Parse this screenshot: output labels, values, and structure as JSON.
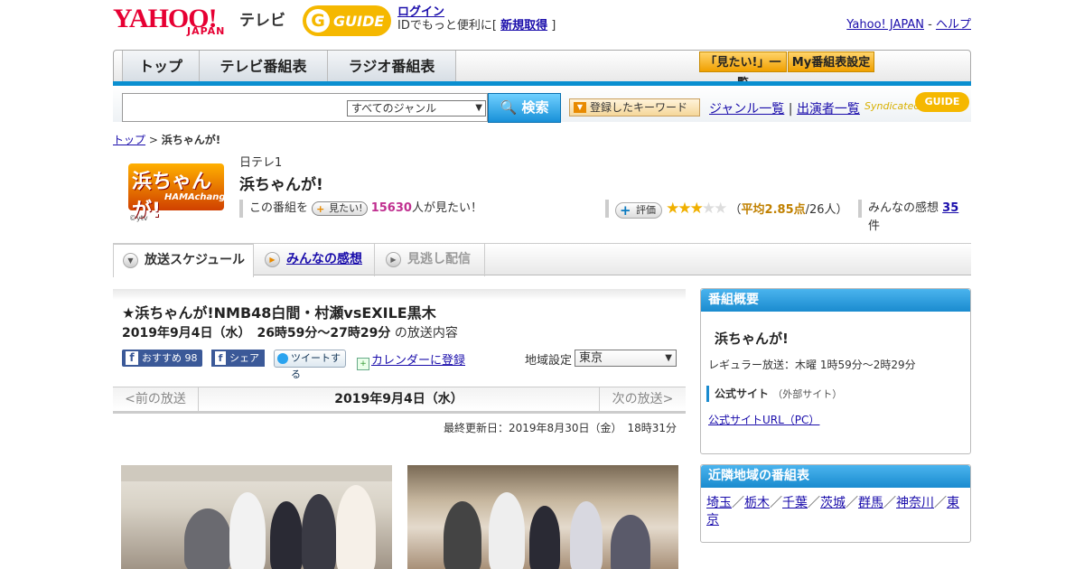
{
  "header": {
    "yahoo_logo": "YAHOO!",
    "yahoo_japan": "JAPAN",
    "tv_label": "テレビ",
    "gguide_g": "G",
    "gguide_text": "GUIDE",
    "login_link": "ログイン",
    "login_text": "IDでもっと便利に[",
    "signup_link": "新規取得",
    "login_close": "]",
    "yahoo_japan_link": "Yahoo! JAPAN",
    "sep": "-",
    "help_link": "ヘルプ"
  },
  "nav": {
    "tabs": [
      {
        "label": "トップ"
      },
      {
        "label": "テレビ番組表"
      },
      {
        "label": "ラジオ番組表"
      }
    ],
    "mitai_list": "「見たい!」一覧",
    "my_schedule": "My番組表設定"
  },
  "search": {
    "query": "",
    "genre": "すべてのジャンル",
    "button": "検索",
    "keyword_button": "登録したキーワード",
    "genre_list": "ジャンル一覧",
    "divider": "|",
    "performer_list": "出演者一覧",
    "syndicated": "Syndicated",
    "synd_gguide": "GUIDE"
  },
  "breadcrumb": {
    "top": "トップ",
    "sep": ">",
    "current": "浜ちゃんが!"
  },
  "program": {
    "logo_text": "浜ちゃんが!",
    "logo_sub": "HAMAchanga",
    "logo_copyright": "©ytv",
    "channel": "日テレ1",
    "title": "浜ちゃんが!",
    "mitai_prefix": "この番組を",
    "mitai_button": "見たい!",
    "mitai_count": "15630",
    "mitai_suffix": "人が見たい！",
    "rate_button": "評価",
    "rating": 2.85,
    "avg_open": "（",
    "avg_label": "平均2.85点",
    "avg_count": "/26人）",
    "impressions_label": "みんなの感想",
    "impressions_count": "35",
    "impressions_unit": "件"
  },
  "subtabs": [
    {
      "label": "放送スケジュール"
    },
    {
      "label": "みんなの感想"
    },
    {
      "label": "見逃し配信"
    }
  ],
  "episode": {
    "title": "★浜ちゃんが!NMB48白間・村瀬vsEXILE黒木",
    "time": "2019年9月4日（水）　26時59分～27時29分",
    "time_suffix": "の放送内容",
    "fb_recommend": "おすすめ",
    "fb_count": "98",
    "fb_share": "シェア",
    "tweet": "ツイートする",
    "calendar": "カレンダーに登録",
    "region_label": "地域設定",
    "region_value": "東京",
    "prev": "<前の放送",
    "current_date": "2019年9月4日（水）",
    "next": "次の放送>",
    "updated": "最終更新日：2019年8月30日（金）　18時31分"
  },
  "overview": {
    "header": "番組概要",
    "name": "浜ちゃんが!",
    "regular": "レギュラー放送：木曜 1時59分～2時29分",
    "official": "公式サイト",
    "official_note": "（外部サイト）",
    "official_url": "公式サイトURL（PC）"
  },
  "nearby": {
    "header": "近隣地域の番組表",
    "areas": [
      "埼玉",
      "栃木",
      "千葉",
      "茨城",
      "群馬",
      "神奈川",
      "東京"
    ],
    "separator": "／"
  },
  "colors": {
    "accent": "#1a8bcf",
    "yahoo_red": "#e60033",
    "gguide_yellow": "#f5b800"
  }
}
